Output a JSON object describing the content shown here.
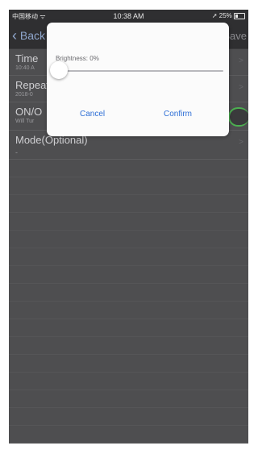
{
  "status_bar": {
    "carrier": "中国移动 ᯤ",
    "time": "10:38 AM",
    "battery": "25%"
  },
  "nav": {
    "back_label": "Back",
    "save_label": "Save"
  },
  "rows": [
    {
      "title": "Time",
      "sub": "10:40 A"
    },
    {
      "title": "Repeat",
      "sub": "2018-0"
    },
    {
      "title": "ON/O",
      "sub": "Will Tur"
    },
    {
      "title": "Mode(Optional)",
      "sub": "-"
    }
  ],
  "dialog": {
    "brightness_label": "Brightness: 0%",
    "brightness_value": 0,
    "cancel_label": "Cancel",
    "confirm_label": "Confirm"
  }
}
